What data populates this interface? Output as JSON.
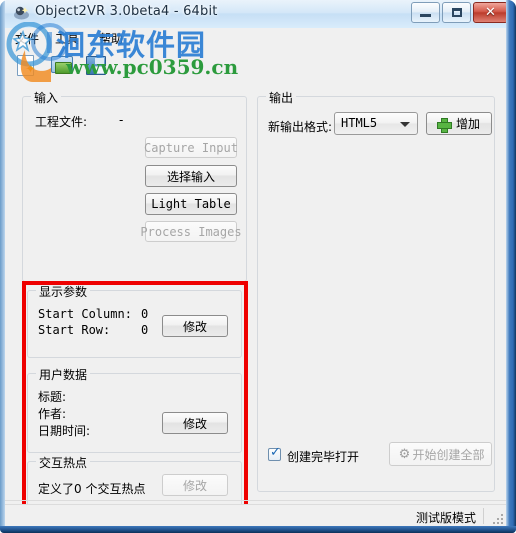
{
  "window": {
    "title": "Object2VR 3.0beta4 - 64bit",
    "icon": "app-icon",
    "controls": {
      "minimize": "minimize",
      "maximize": "maximize",
      "close": "close"
    }
  },
  "menubar": {
    "items": [
      {
        "label": "文件",
        "name": "menu-file"
      },
      {
        "label": "工具",
        "name": "menu-tools"
      },
      {
        "label": "帮助",
        "name": "menu-help"
      }
    ]
  },
  "toolbar": {
    "buttons": [
      {
        "name": "new-project-button",
        "icon": "new-document-icon"
      },
      {
        "name": "open-project-button",
        "icon": "open-folder-icon"
      },
      {
        "name": "save-project-button",
        "icon": "save-floppy-icon"
      }
    ]
  },
  "watermark": {
    "site_name": "洄东软件园",
    "url": "www.pc0359.cn",
    "colors": {
      "site_name": "#2c7fd4",
      "url": "#2c9b3d",
      "logo": "#f08a1e"
    }
  },
  "input_group": {
    "title": "输入",
    "project_file_label": "工程文件:",
    "project_file_value": "-",
    "buttons": [
      {
        "label": "Capture Input",
        "enabled": false
      },
      {
        "label": "选择输入",
        "enabled": true
      },
      {
        "label": "Light Table",
        "enabled": true
      },
      {
        "label": "Process Images",
        "enabled": false
      }
    ]
  },
  "display_params_group": {
    "title": "显示参数",
    "rows": [
      {
        "label": "Start Column:",
        "value": "0"
      },
      {
        "label": "Start Row:",
        "value": "0"
      }
    ],
    "modify_button": {
      "label": "修改",
      "enabled": true
    }
  },
  "user_data_group": {
    "title": "用户数据",
    "rows": [
      {
        "label": "标题:",
        "value": ""
      },
      {
        "label": "作者:",
        "value": ""
      },
      {
        "label": "日期时间:",
        "value": ""
      }
    ],
    "modify_button": {
      "label": "修改",
      "enabled": true
    }
  },
  "hotspots_group": {
    "title": "交互热点",
    "summary": "定义了0 个交互热点",
    "modify_button": {
      "label": "修改",
      "enabled": false
    }
  },
  "output_group": {
    "title": "输出",
    "format_label": "新输出格式:",
    "format_value": "HTML5",
    "format_options": [
      "HTML5"
    ],
    "add_button": {
      "label": "增加",
      "icon": "plus-icon",
      "enabled": true
    }
  },
  "footer": {
    "open_when_done": {
      "label": "创建完毕打开",
      "checked": true
    },
    "start_button": {
      "label": "开始创建全部",
      "icon": "gear-icon",
      "enabled": false
    }
  },
  "statusbar": {
    "text": "测试版模式"
  },
  "annotation": {
    "highlight_color": "#ee0000"
  }
}
